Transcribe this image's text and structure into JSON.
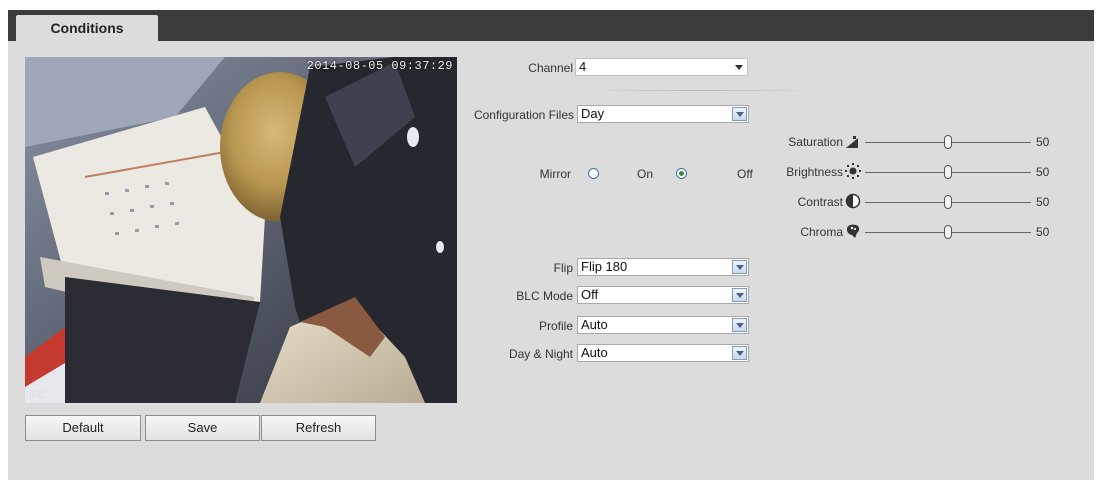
{
  "tab": {
    "label": "Conditions"
  },
  "video": {
    "timestamp": "2014-08-05 09:37:29",
    "corner_label": "IFC"
  },
  "form": {
    "channel": {
      "label": "Channel",
      "value": "4"
    },
    "config_files": {
      "label": "Configuration Files",
      "value": "Day"
    },
    "mirror": {
      "label": "Mirror",
      "options": [
        "On",
        "Off"
      ],
      "selected": "Off"
    },
    "flip": {
      "label": "Flip",
      "value": "Flip 180"
    },
    "blc": {
      "label": "BLC Mode",
      "value": "Off"
    },
    "profile": {
      "label": "Profile",
      "value": "Auto"
    },
    "daynight": {
      "label": "Day & Night",
      "value": "Auto"
    }
  },
  "sliders": [
    {
      "label": "Saturation",
      "icon": "saturation-icon",
      "value": "50",
      "level": 0.5
    },
    {
      "label": "Brightness",
      "icon": "brightness-icon",
      "value": "50",
      "level": 0.5
    },
    {
      "label": "Contrast",
      "icon": "contrast-icon",
      "value": "50",
      "level": 0.5
    },
    {
      "label": "Chroma",
      "icon": "chroma-icon",
      "value": "50",
      "level": 0.5
    }
  ],
  "buttons": {
    "default": "Default",
    "save": "Save",
    "refresh": "Refresh"
  },
  "colors": {
    "topbar": "#3c3c3c",
    "panel": "#dcdcdc",
    "radio_selected": "#3a8a3a"
  }
}
